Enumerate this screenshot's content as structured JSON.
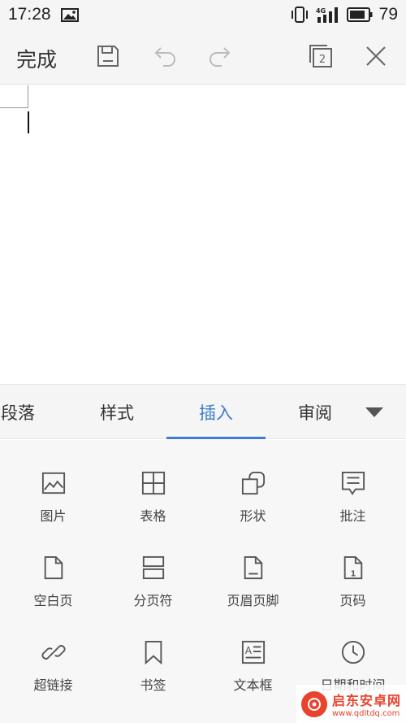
{
  "status_bar": {
    "time": "17:28",
    "battery": "79",
    "network": "4G"
  },
  "toolbar": {
    "done_label": "完成",
    "window_count": "2"
  },
  "tabs": [
    {
      "label": "段落",
      "active": false
    },
    {
      "label": "样式",
      "active": false
    },
    {
      "label": "插入",
      "active": true
    },
    {
      "label": "审阅",
      "active": false
    }
  ],
  "insert_items": [
    {
      "label": "图片",
      "icon": "picture-icon"
    },
    {
      "label": "表格",
      "icon": "table-icon"
    },
    {
      "label": "形状",
      "icon": "shape-icon"
    },
    {
      "label": "批注",
      "icon": "comment-icon"
    },
    {
      "label": "空白页",
      "icon": "blank-page-icon"
    },
    {
      "label": "分页符",
      "icon": "page-break-icon"
    },
    {
      "label": "页眉页脚",
      "icon": "header-footer-icon"
    },
    {
      "label": "页码",
      "icon": "page-number-icon"
    },
    {
      "label": "超链接",
      "icon": "hyperlink-icon"
    },
    {
      "label": "书签",
      "icon": "bookmark-icon"
    },
    {
      "label": "文本框",
      "icon": "textbox-icon"
    },
    {
      "label": "日期和时间",
      "icon": "clock-icon"
    }
  ],
  "watermark": {
    "name": "启东安卓网",
    "url": "www.qdltdq.com"
  },
  "colors": {
    "accent": "#3d7cd1",
    "toolbar_bg": "#f5f5f5",
    "icon_gray": "#555555",
    "disabled_gray": "#bbbbbb"
  }
}
